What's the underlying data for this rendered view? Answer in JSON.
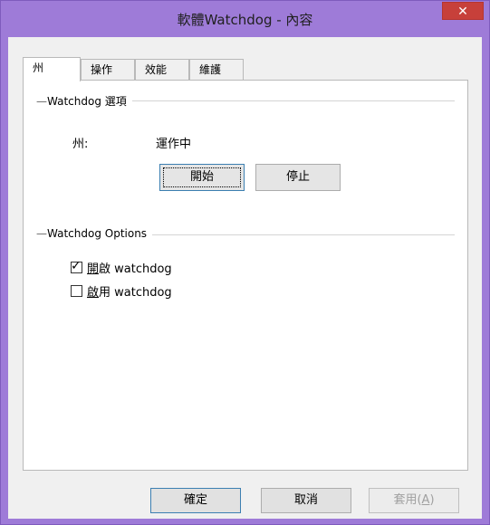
{
  "window": {
    "title": "軟體Watchdog - 內容",
    "close_glyph": "✕"
  },
  "tabs": [
    {
      "label": "州",
      "active": true
    },
    {
      "label": "操作",
      "active": false
    },
    {
      "label": "效能",
      "active": false
    },
    {
      "label": "維護",
      "active": false
    }
  ],
  "section1": {
    "title": "Watchdog 選項",
    "state_label": "州:",
    "state_value": "運作中",
    "start_button": "開始",
    "stop_button": "停止"
  },
  "section2": {
    "title": "Watchdog Options",
    "option1": {
      "label_prefix": "開",
      "label_rest": "啟 watchdog",
      "checked": true
    },
    "option2": {
      "label_prefix": "啟",
      "label_rest": "用 watchdog",
      "checked": false
    }
  },
  "footer": {
    "ok": "確定",
    "cancel": "取消",
    "apply_prefix": "套用(",
    "apply_accel": "A",
    "apply_suffix": ")"
  },
  "colors": {
    "frame": "#9e7bd8",
    "close": "#c7403a"
  },
  "icons": {
    "close": "close-icon",
    "check": "checkmark-icon"
  }
}
